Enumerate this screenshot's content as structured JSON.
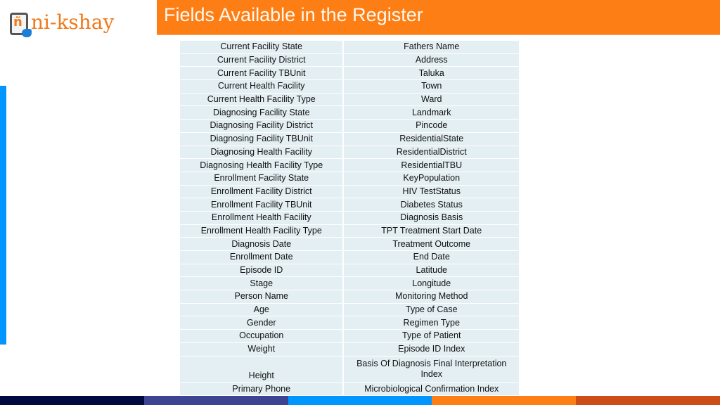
{
  "logo": {
    "glyph": "ñ",
    "wordmark": "ni-kshay",
    "icon": "tablet-touch-icon"
  },
  "header": {
    "title": "Fields Available in the Register"
  },
  "colors": {
    "title_bar": "#fd7e14",
    "left_accent": "#0096ff",
    "cell_bg": "#e4eff3",
    "footer": [
      "#000a40",
      "#3d4492",
      "#0096ff",
      "#fd7e14",
      "#cc4e16"
    ]
  },
  "table": {
    "rows": [
      [
        "Current Facility State",
        "Fathers Name"
      ],
      [
        "Current Facility District",
        "Address"
      ],
      [
        "Current Facility TBUnit",
        "Taluka"
      ],
      [
        "Current Health Facility",
        "Town"
      ],
      [
        "Current Health Facility Type",
        "Ward"
      ],
      [
        "Diagnosing Facility State",
        "Landmark"
      ],
      [
        "Diagnosing Facility District",
        "Pincode"
      ],
      [
        "Diagnosing Facility TBUnit",
        "ResidentialState"
      ],
      [
        "Diagnosing Health Facility",
        "ResidentialDistrict"
      ],
      [
        "Diagnosing Health Facility Type",
        "ResidentialTBU"
      ],
      [
        "Enrollment Facility State",
        "KeyPopulation"
      ],
      [
        "Enrollment Facility District",
        "HIV TestStatus"
      ],
      [
        "Enrollment Facility TBUnit",
        "Diabetes Status"
      ],
      [
        "Enrollment Health Facility",
        "Diagnosis Basis"
      ],
      [
        "Enrollment Health Facility Type",
        "TPT Treatment Start Date"
      ],
      [
        "Diagnosis Date",
        "Treatment Outcome"
      ],
      [
        "Enrollment Date",
        "End Date"
      ],
      [
        "Episode ID",
        "Latitude"
      ],
      [
        "Stage",
        "Longitude"
      ],
      [
        "Person Name",
        "Monitoring Method"
      ],
      [
        "Age",
        "Type of Case"
      ],
      [
        "Gender",
        "Regimen Type"
      ],
      [
        "Occupation",
        "Type of Patient"
      ],
      [
        "Weight",
        "Episode ID Index"
      ],
      [
        "Height",
        "Basis Of Diagnosis Final Interpretation Index"
      ],
      [
        "Primary Phone",
        "Microbiological Confirmation Index"
      ]
    ]
  }
}
